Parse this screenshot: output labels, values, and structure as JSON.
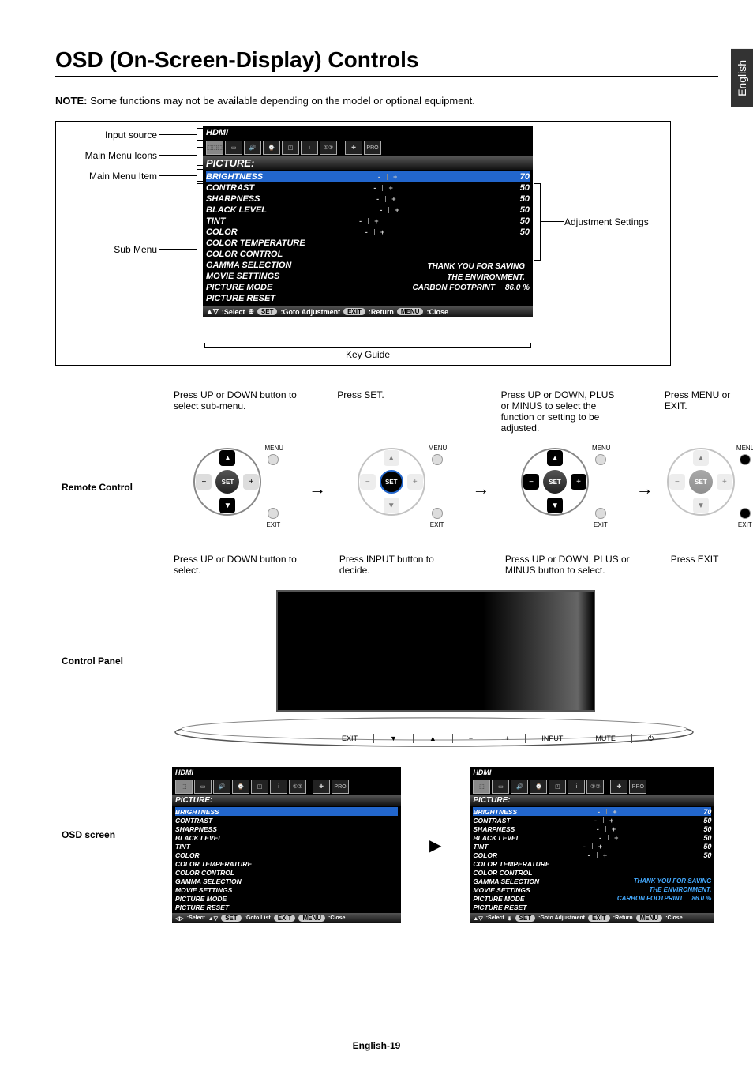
{
  "page": {
    "title": "OSD (On-Screen-Display) Controls",
    "lang_tab": "English",
    "note_label": "NOTE:",
    "note_text": "Some functions may not be available depending on the model or optional equipment.",
    "footer": "English-19"
  },
  "diagram_labels": {
    "input_source": "Input source",
    "main_menu_icons": "Main Menu Icons",
    "main_menu_item": "Main Menu Item",
    "sub_menu": "Sub Menu",
    "adjustment_settings": "Adjustment Settings",
    "key_guide": "Key Guide"
  },
  "osd": {
    "input": "HDMI",
    "tabs": [
      "PICTURE",
      "ADJUST",
      "AUDIO",
      "SCHEDULE",
      "PIP",
      "OSD",
      "MULTI DSP",
      "PROTECT",
      "ADVANCED",
      "PRO"
    ],
    "section": "PICTURE:",
    "items": [
      {
        "label": "BRIGHTNESS",
        "val": "70",
        "slider": true,
        "hl": true
      },
      {
        "label": "CONTRAST",
        "val": "50",
        "slider": true
      },
      {
        "label": "SHARPNESS",
        "val": "50",
        "slider": true
      },
      {
        "label": "BLACK LEVEL",
        "val": "50",
        "slider": true
      },
      {
        "label": "TINT",
        "val": "50",
        "slider": true
      },
      {
        "label": "COLOR",
        "val": "50",
        "slider": true
      },
      {
        "label": "COLOR TEMPERATURE",
        "slider": false
      },
      {
        "label": "COLOR CONTROL",
        "slider": false
      },
      {
        "label": "GAMMA SELECTION",
        "slider": false
      },
      {
        "label": "MOVIE SETTINGS",
        "slider": false
      },
      {
        "label": "PICTURE MODE",
        "slider": false
      },
      {
        "label": "PICTURE RESET",
        "slider": false
      }
    ],
    "thank1": "THANK YOU FOR SAVING",
    "thank2": "THE ENVIRONMENT.",
    "carbon_label": "CARBON FOOTPRINT",
    "carbon_val": "86.0 %",
    "keyguide_select": ":Select",
    "keyguide_goto_adj": ":Goto Adjustment",
    "keyguide_goto_list": ":Goto List",
    "keyguide_return": ":Return",
    "keyguide_close": ":Close",
    "pill_set": "SET",
    "pill_exit": "EXIT",
    "pill_menu": "MENU",
    "plus": "+",
    "minus": "-"
  },
  "remote": {
    "title": "Remote Control",
    "steps": [
      "Press UP or DOWN button to select sub-menu.",
      "Press SET.",
      "Press UP or DOWN, PLUS or MINUS to select the function or setting to be adjusted.",
      "Press MENU or EXIT."
    ],
    "btn_set": "SET",
    "btn_menu": "MENU",
    "btn_exit": "EXIT",
    "sym_minus": "−",
    "sym_plus": "+"
  },
  "panel": {
    "title": "Control Panel",
    "steps": [
      "Press UP or DOWN button to select.",
      "Press INPUT button to decide.",
      "Press UP or DOWN, PLUS or MINUS button to select.",
      "Press EXIT"
    ],
    "buttons": [
      "EXIT",
      "▼",
      "▲",
      "−",
      "+",
      "INPUT",
      "MUTE"
    ],
    "power": "⏻"
  },
  "osd_screen": {
    "title": "OSD screen"
  }
}
